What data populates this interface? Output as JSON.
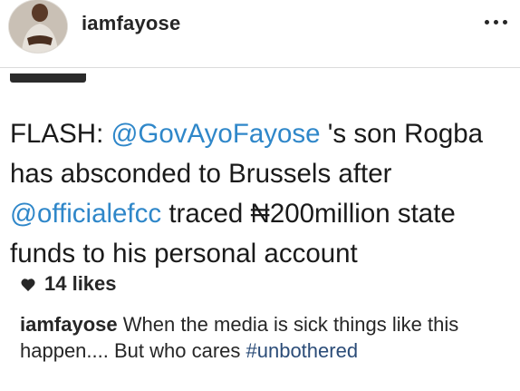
{
  "post": {
    "username": "iamfayose",
    "tweet": {
      "prefix": "FLASH: ",
      "mention1": "@GovAyoFayose",
      "mid1": " 's son Rogba has absconded to Brussels after ",
      "mention2": "@officialefcc",
      "rest": " traced ₦200million state funds to his personal account"
    },
    "likes": "14 likes",
    "caption": {
      "username": "iamfayose",
      "text": " When the media is sick things like this happen.... But who cares ",
      "hashtag": "#unbothered"
    }
  },
  "icons": {
    "more": "more-options-icon",
    "like": "heart-icon"
  },
  "colors": {
    "mention": "#2f87c9",
    "hashtag": "#2b4c78",
    "text": "#262626"
  }
}
